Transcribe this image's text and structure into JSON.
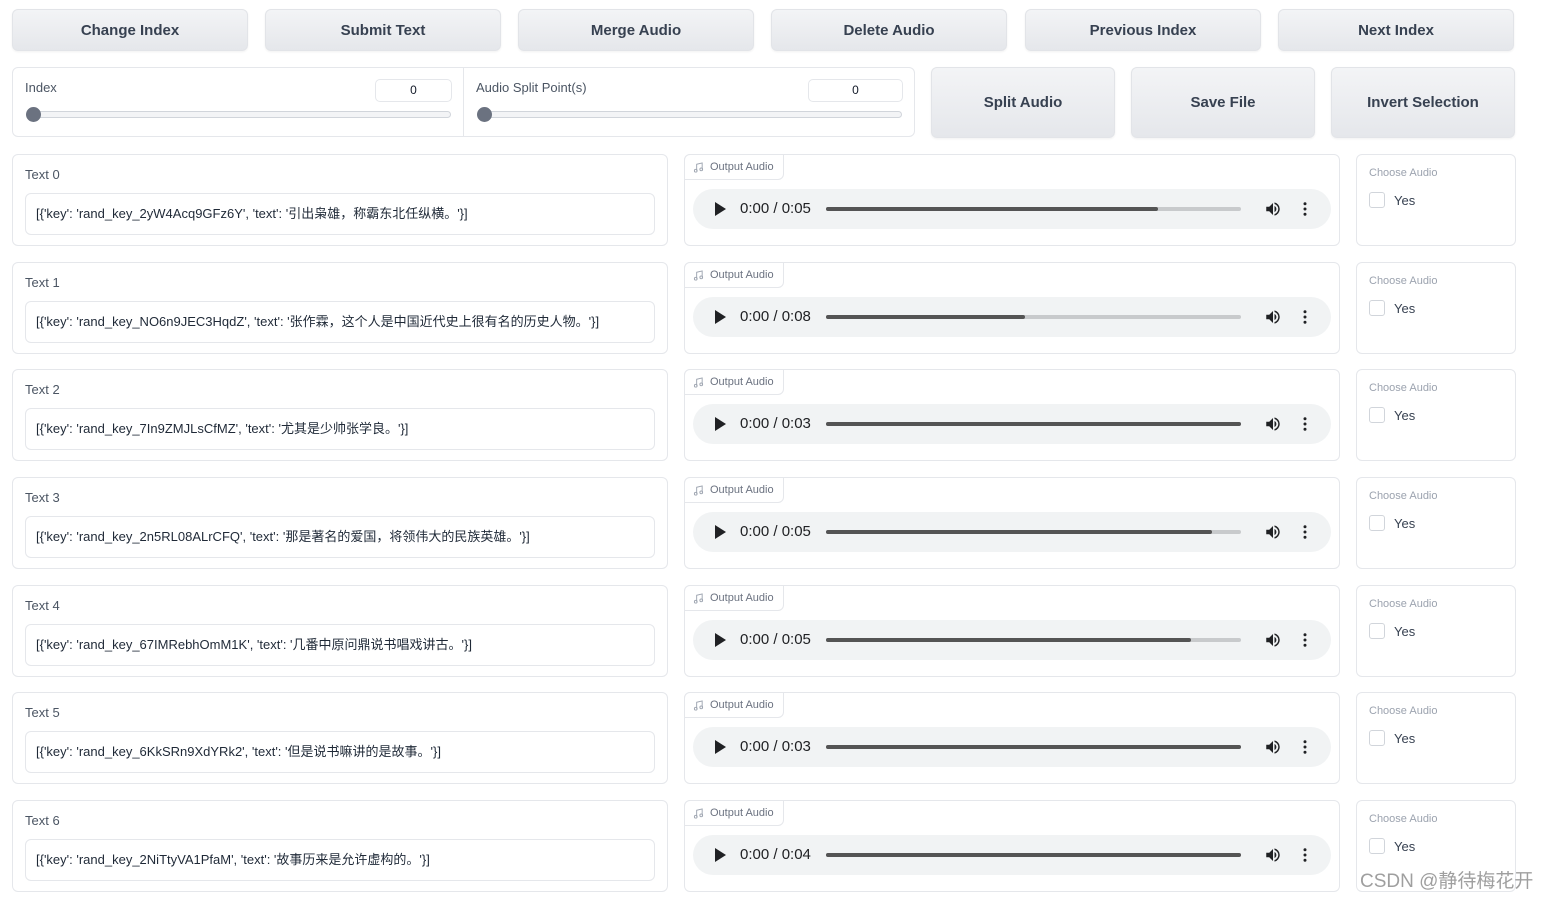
{
  "toolbar": {
    "change_index": "Change Index",
    "submit_text": "Submit Text",
    "merge_audio": "Merge Audio",
    "delete_audio": "Delete Audio",
    "previous_index": "Previous Index",
    "next_index": "Next Index"
  },
  "controls": {
    "index_label": "Index",
    "index_value": "0",
    "split_label": "Audio Split Point(s)",
    "split_value": "0",
    "split_audio": "Split Audio",
    "save_file": "Save File",
    "invert_selection": "Invert Selection"
  },
  "rows": [
    {
      "label": "Text 0",
      "text": "[{'key': 'rand_key_2yW4Acq9GFz6Y', 'text': '引出枭雄，称霸东北任纵横。'}]",
      "audio_label": "Output Audio",
      "time": "0:00 / 0:05",
      "progress": 0.8,
      "choose_label": "Choose Audio",
      "yes": "Yes"
    },
    {
      "label": "Text 1",
      "text": "[{'key': 'rand_key_NO6n9JEC3HqdZ', 'text': '张作霖，这个人是中国近代史上很有名的历史人物。'}]",
      "audio_label": "Output Audio",
      "time": "0:00 / 0:08",
      "progress": 0.48,
      "choose_label": "Choose Audio",
      "yes": "Yes"
    },
    {
      "label": "Text 2",
      "text": "[{'key': 'rand_key_7In9ZMJLsCfMZ', 'text': '尤其是少帅张学良。'}]",
      "audio_label": "Output Audio",
      "time": "0:00 / 0:03",
      "progress": 1.0,
      "choose_label": "Choose Audio",
      "yes": "Yes"
    },
    {
      "label": "Text 3",
      "text": "[{'key': 'rand_key_2n5RL08ALrCFQ', 'text': '那是著名的爱国，将领伟大的民族英雄。'}]",
      "audio_label": "Output Audio",
      "time": "0:00 / 0:05",
      "progress": 0.93,
      "choose_label": "Choose Audio",
      "yes": "Yes"
    },
    {
      "label": "Text 4",
      "text": "[{'key': 'rand_key_67IMRebhOmM1K', 'text': '几番中原问鼎说书唱戏讲古。'}]",
      "audio_label": "Output Audio",
      "time": "0:00 / 0:05",
      "progress": 0.88,
      "choose_label": "Choose Audio",
      "yes": "Yes"
    },
    {
      "label": "Text 5",
      "text": "[{'key': 'rand_key_6KkSRn9XdYRk2', 'text': '但是说书嘛讲的是故事。'}]",
      "audio_label": "Output Audio",
      "time": "0:00 / 0:03",
      "progress": 1.0,
      "choose_label": "Choose Audio",
      "yes": "Yes"
    },
    {
      "label": "Text 6",
      "text": "[{'key': 'rand_key_2NiTtyVA1PfaM', 'text': '故事历来是允许虚构的。'}]",
      "audio_label": "Output Audio",
      "time": "0:00 / 0:04",
      "progress": 1.0,
      "choose_label": "Choose Audio",
      "yes": "Yes"
    }
  ],
  "watermark": "CSDN @静待梅花开"
}
